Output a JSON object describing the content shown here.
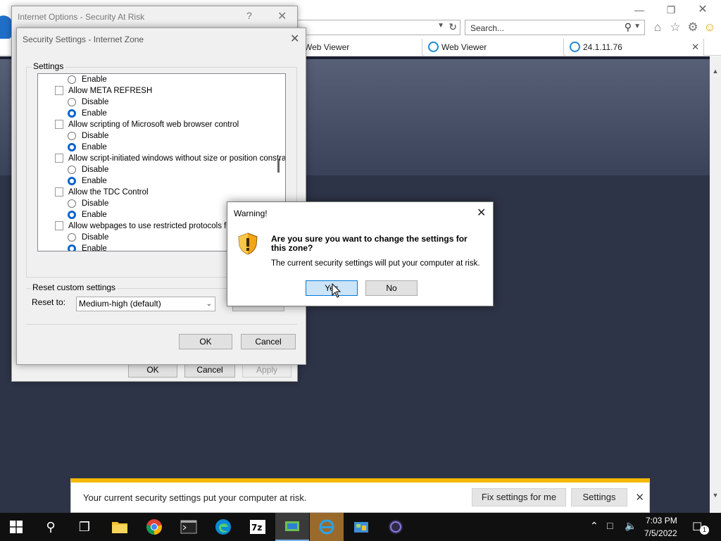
{
  "browser": {
    "search_placeholder": "Search...",
    "tabs": [
      {
        "label": "Web Viewer"
      },
      {
        "label": "Web Viewer"
      },
      {
        "label": "24.1.11.76"
      }
    ]
  },
  "internet_options": {
    "title": "Internet Options - Security At Risk",
    "help_label": "?",
    "ok_label": "OK",
    "cancel_label": "Cancel",
    "apply_label": "Apply"
  },
  "security_settings": {
    "title": "Security Settings - Internet Zone",
    "settings_label": "Settings",
    "items": [
      {
        "kind": "option",
        "label": "Enable",
        "selected": false
      },
      {
        "kind": "category",
        "label": "Allow META REFRESH"
      },
      {
        "kind": "option",
        "label": "Disable",
        "selected": false
      },
      {
        "kind": "option",
        "label": "Enable",
        "selected": true
      },
      {
        "kind": "category",
        "label": "Allow scripting of Microsoft web browser control"
      },
      {
        "kind": "option",
        "label": "Disable",
        "selected": false
      },
      {
        "kind": "option",
        "label": "Enable",
        "selected": true
      },
      {
        "kind": "category",
        "label": "Allow script-initiated windows without size or position constra"
      },
      {
        "kind": "option",
        "label": "Disable",
        "selected": false
      },
      {
        "kind": "option",
        "label": "Enable",
        "selected": true
      },
      {
        "kind": "category",
        "label": "Allow the TDC Control"
      },
      {
        "kind": "option",
        "label": "Disable",
        "selected": false
      },
      {
        "kind": "option",
        "label": "Enable",
        "selected": true
      },
      {
        "kind": "category",
        "label": "Allow webpages to use restricted protocols for a"
      },
      {
        "kind": "option",
        "label": "Disable",
        "selected": false
      },
      {
        "kind": "option",
        "label": "Enable",
        "selected": true
      }
    ],
    "reset_group_label": "Reset custom settings",
    "reset_to_label": "Reset to:",
    "reset_to_value": "Medium-high (default)",
    "ok_label": "OK",
    "cancel_label": "Cancel"
  },
  "warning": {
    "title": "Warning!",
    "question": "Are you sure you want to change the settings for this zone?",
    "info": "The current security settings will put your computer at risk.",
    "yes_label": "Yes",
    "no_label": "No"
  },
  "notification": {
    "message": "Your current security settings put your computer at risk.",
    "fix_label": "Fix settings for me",
    "settings_label": "Settings"
  },
  "taskbar": {
    "time": "7:03 PM",
    "date": "7/5/2022",
    "notification_count": "1"
  }
}
